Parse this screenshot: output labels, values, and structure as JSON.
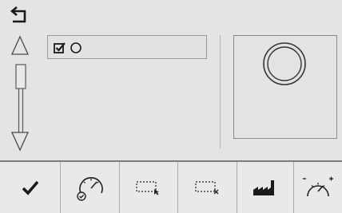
{
  "header": {
    "back_icon": "back-arrow-icon"
  },
  "scroll": {
    "up_icon": "triangle-up-icon",
    "down_icon": "triangle-down-icon"
  },
  "field": {
    "checkbox_icon": "checked-box-icon",
    "radio_icon": "radio-circle-icon",
    "checked": true,
    "radio_selected": false
  },
  "preview": {
    "shape_icon": "double-circle-icon"
  },
  "toolbar": {
    "items": [
      {
        "icon": "checkmark-icon"
      },
      {
        "icon": "gauge-check-icon"
      },
      {
        "icon": "selection-arrow-icon"
      },
      {
        "icon": "selection-delete-icon"
      },
      {
        "icon": "factory-icon"
      },
      {
        "icon": "gauge-plus-minus-icon"
      }
    ]
  },
  "colors": {
    "background": "#e4e4e4",
    "toolbar": "#e9e9e9",
    "ink": "#1a1a1a",
    "outline": "#7d7d7d"
  }
}
